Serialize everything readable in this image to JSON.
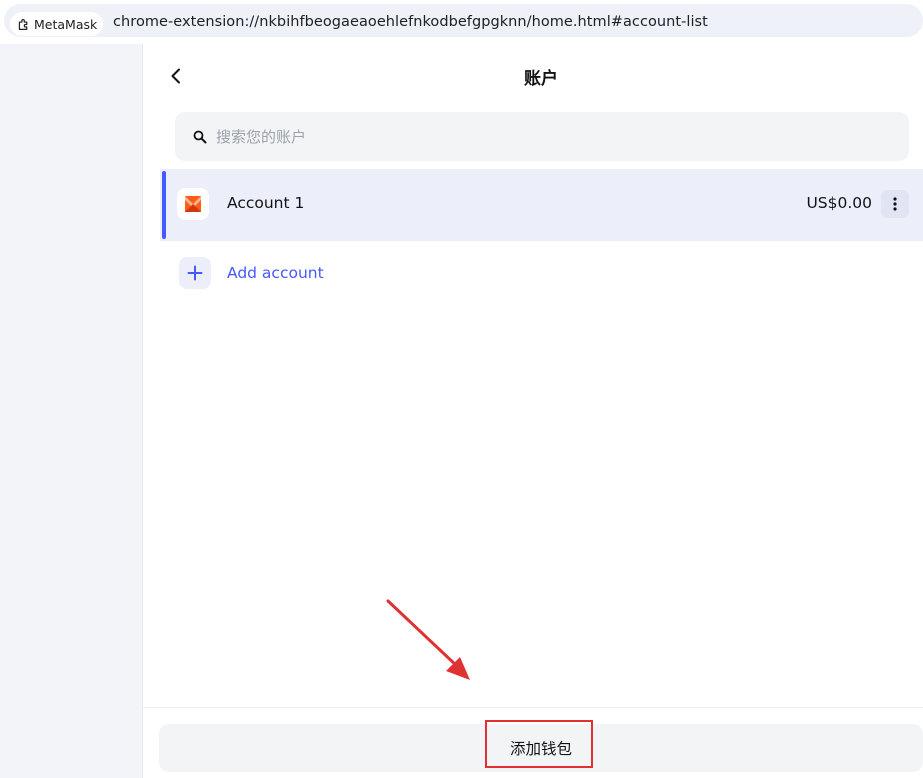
{
  "browser": {
    "extension_chip": "MetaMask",
    "url": "chrome-extension://nkbihfbeogaeaoehlefnkodbefgpgknn/home.html#account-list"
  },
  "header": {
    "title": "账户"
  },
  "search": {
    "placeholder": "搜索您的账户",
    "value": ""
  },
  "accounts": [
    {
      "name": "Account 1",
      "balance": "US$0.00",
      "selected": true
    }
  ],
  "actions": {
    "add_account_label": "Add account",
    "add_wallet_label": "添加钱包"
  },
  "colors": {
    "accent": "#4459ff",
    "selected_row_bg": "#eceefa",
    "annotation": "#e03232",
    "avatar_orange": "#ff5c16"
  },
  "icons": {
    "back": "arrow-left-icon",
    "search": "search-icon",
    "more": "more-vertical-icon",
    "add": "plus-icon",
    "extension": "puzzle-icon"
  }
}
